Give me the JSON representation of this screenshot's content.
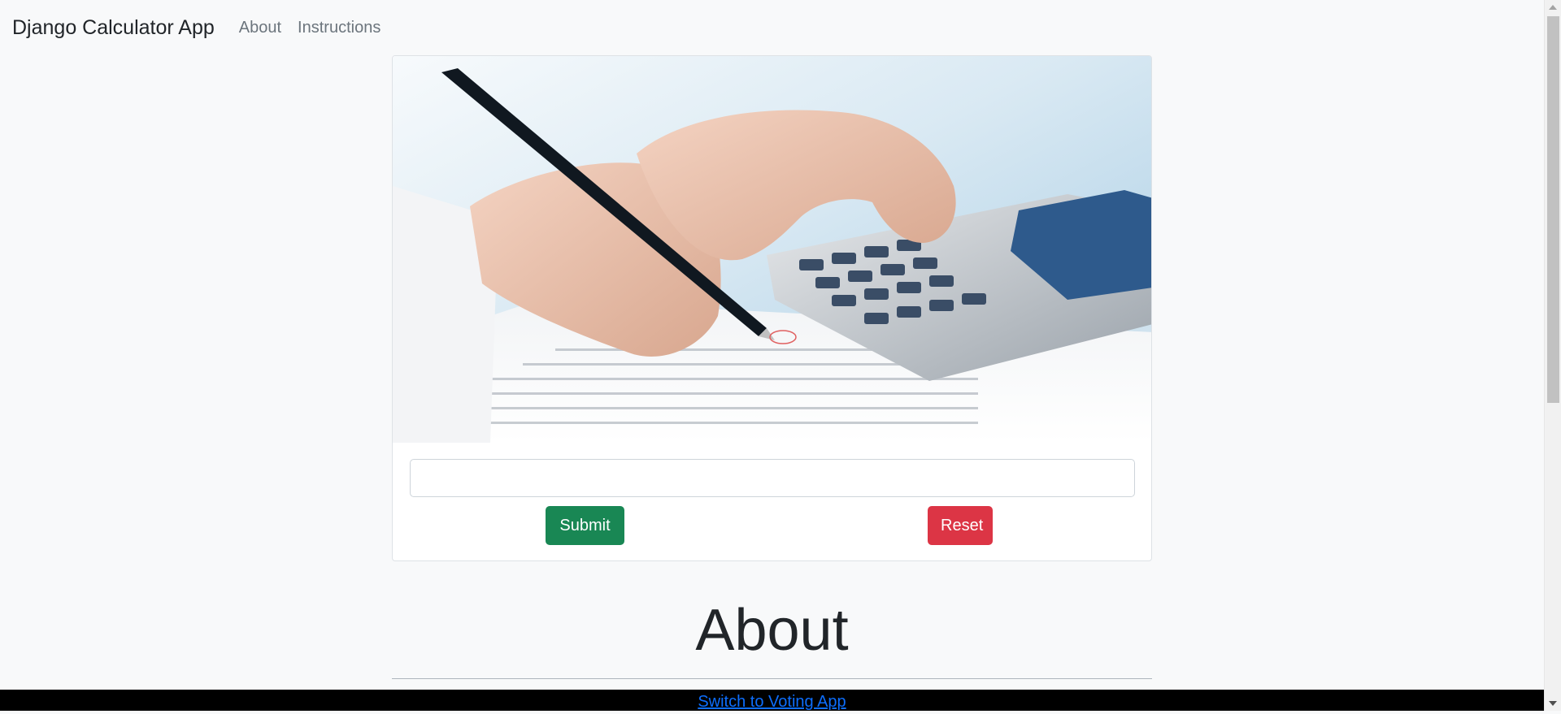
{
  "navbar": {
    "brand": "Django Calculator App",
    "links": [
      "About",
      "Instructions"
    ]
  },
  "calculator": {
    "input_value": "",
    "input_placeholder": "",
    "submit_label": "Submit",
    "reset_label": "Reset"
  },
  "about": {
    "title": "About"
  },
  "footer": {
    "link_text": "Switch to Voting App"
  },
  "colors": {
    "background": "#f8f9fa",
    "submit": "#198754",
    "reset": "#dc3545",
    "footer": "#000000",
    "link": "#0d6efd"
  },
  "icons": {
    "hero_image": "calculator-and-pen-photo",
    "scroll_up": "chevron-up-icon",
    "scroll_down": "chevron-down-icon"
  }
}
